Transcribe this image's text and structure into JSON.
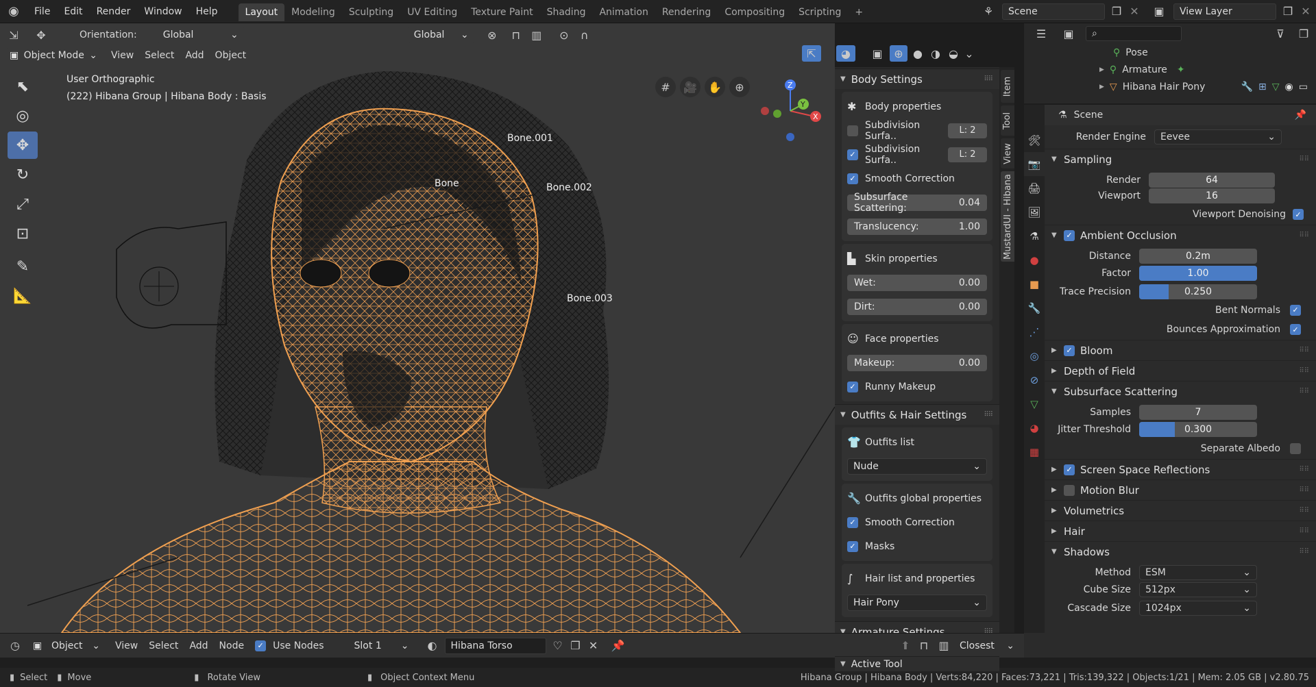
{
  "topbar": {
    "menus": [
      "File",
      "Edit",
      "Render",
      "Window",
      "Help"
    ],
    "workspaces": [
      "Layout",
      "Modeling",
      "Sculpting",
      "UV Editing",
      "Texture Paint",
      "Shading",
      "Animation",
      "Rendering",
      "Compositing",
      "Scripting"
    ],
    "active_workspace": "Layout",
    "scene": "Scene",
    "view_layer": "View Layer"
  },
  "viewport": {
    "orientation_label": "Orientation:",
    "orientation_value": "Global",
    "transform_orientation": "Global",
    "mode": "Object Mode",
    "menus": [
      "View",
      "Select",
      "Add",
      "Object"
    ],
    "view_name": "User Orthographic",
    "object_info": "(222) Hibana Group | Hibana Body : Basis",
    "bones": [
      "Bone.001",
      "Bone",
      "Bone.002",
      "Bone.003"
    ],
    "gizmo_axes": [
      "Z",
      "Y",
      "X"
    ]
  },
  "npanel": {
    "tabs": [
      "Item",
      "Tool",
      "View",
      "MustardUI - Hibana"
    ],
    "body_settings": {
      "title": "Body Settings",
      "body_props": "Body properties",
      "subdiv1": {
        "label": "Subdivision Surfa..",
        "level": "L: 2",
        "checked": false
      },
      "subdiv2": {
        "label": "Subdivision Surfa..",
        "level": "L: 2",
        "checked": true
      },
      "smooth_correction": "Smooth Correction",
      "sss": {
        "label": "Subsurface Scattering:",
        "value": "0.04"
      },
      "translucency": {
        "label": "Translucency:",
        "value": "1.00"
      },
      "skin_props": "Skin properties",
      "wet": {
        "label": "Wet:",
        "value": "0.00"
      },
      "dirt": {
        "label": "Dirt:",
        "value": "0.00"
      },
      "face_props": "Face properties",
      "makeup": {
        "label": "Makeup:",
        "value": "0.00"
      },
      "runny_makeup": "Runny Makeup"
    },
    "outfits": {
      "title": "Outfits & Hair Settings",
      "outfits_list": "Outfits list",
      "outfit_value": "Nude",
      "global_props": "Outfits global properties",
      "smooth_correction": "Smooth Correction",
      "masks": "Masks",
      "hair_list": "Hair list and properties",
      "hair_value": "Hair Pony"
    },
    "armature": {
      "title": "Armature Settings"
    },
    "active_tool": {
      "title": "Active Tool"
    }
  },
  "outliner": {
    "items": [
      {
        "label": "Pose",
        "icon": "pose-icon"
      },
      {
        "label": "Armature",
        "icon": "armature-icon"
      },
      {
        "label": "Hibana Hair Pony",
        "icon": "mesh-icon"
      }
    ]
  },
  "properties": {
    "context": "Scene",
    "render_engine_label": "Render Engine",
    "render_engine": "Eevee",
    "sampling": {
      "title": "Sampling",
      "render_label": "Render",
      "render": "64",
      "viewport_label": "Viewport",
      "viewport": "16",
      "denoise": "Viewport Denoising"
    },
    "ao": {
      "title": "Ambient Occlusion",
      "distance_label": "Distance",
      "distance": "0.2m",
      "factor_label": "Factor",
      "factor": "1.00",
      "factor_fill": 1.0,
      "precision_label": "Trace Precision",
      "precision": "0.250",
      "precision_fill": 0.25,
      "bent": "Bent Normals",
      "bounces": "Bounces Approximation"
    },
    "bloom": "Bloom",
    "dof": "Depth of Field",
    "sss": {
      "title": "Subsurface Scattering",
      "samples_label": "Samples",
      "samples": "7",
      "jitter_label": "Jitter Threshold",
      "jitter": "0.300",
      "jitter_fill": 0.3,
      "albedo": "Separate Albedo"
    },
    "ssr": "Screen Space Reflections",
    "motion_blur": "Motion Blur",
    "volumetrics": "Volumetrics",
    "hair": "Hair",
    "shadows": {
      "title": "Shadows",
      "method_label": "Method",
      "method": "ESM",
      "cube_label": "Cube Size",
      "cube": "512px",
      "cascade_label": "Cascade Size",
      "cascade": "1024px"
    }
  },
  "node_header": {
    "type": "Object",
    "menus": [
      "View",
      "Select",
      "Add",
      "Node"
    ],
    "use_nodes": "Use Nodes",
    "slot": "Slot 1",
    "material": "Hibana Torso",
    "snap": "Closest"
  },
  "statusbar": {
    "select": "Select",
    "move": "Move",
    "rotate": "Rotate View",
    "context_menu": "Object Context Menu",
    "stats": "Hibana Group | Hibana Body | Verts:84,220 | Faces:73,221 | Tris:139,322 | Objects:1/21 | Mem: 2.05 GB | v2.80.75"
  },
  "colors": {
    "accent": "#4a7cc5",
    "wire": "#f0a050",
    "active_tool": "#4d6fa8"
  }
}
